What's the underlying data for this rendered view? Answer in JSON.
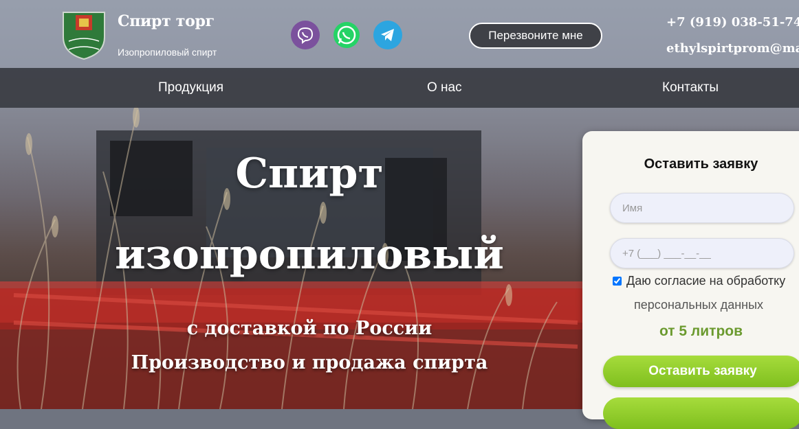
{
  "header": {
    "brand_name": "Спирт торг",
    "brand_tagline": "Изопропиловый спирт",
    "logo_icon": "coat-of-arms-shield-icon",
    "messengers": [
      {
        "name": "viber-icon",
        "color": "#7b519d"
      },
      {
        "name": "whatsapp-icon",
        "color": "#25d366"
      },
      {
        "name": "telegram-icon",
        "color": "#2ca5e0"
      }
    ],
    "callback_label": "Перезвоните мне",
    "phone": "+7 (919) 038-51-74",
    "email": "ethylspirtprom@mai"
  },
  "nav": {
    "items": [
      {
        "label": "Продукция"
      },
      {
        "label": "О нас"
      },
      {
        "label": "Контакты"
      }
    ]
  },
  "hero": {
    "title_line1": "Спирт",
    "title_line2": "изопропиловый",
    "subtitle_line1": "с доставкой по России",
    "subtitle_line2": "Производство и продажа спирта"
  },
  "form": {
    "title": "Оставить заявку",
    "name_placeholder": "Имя",
    "phone_placeholder": "+7 (___) ___-__-__",
    "consent_line1": "Даю согласие на обработку",
    "consent_line2": "персональных данных",
    "consent_checked": true,
    "min_volume": "от 5 литров",
    "submit_label": "Оставить заявку",
    "accent_color": "#8cc63f"
  }
}
